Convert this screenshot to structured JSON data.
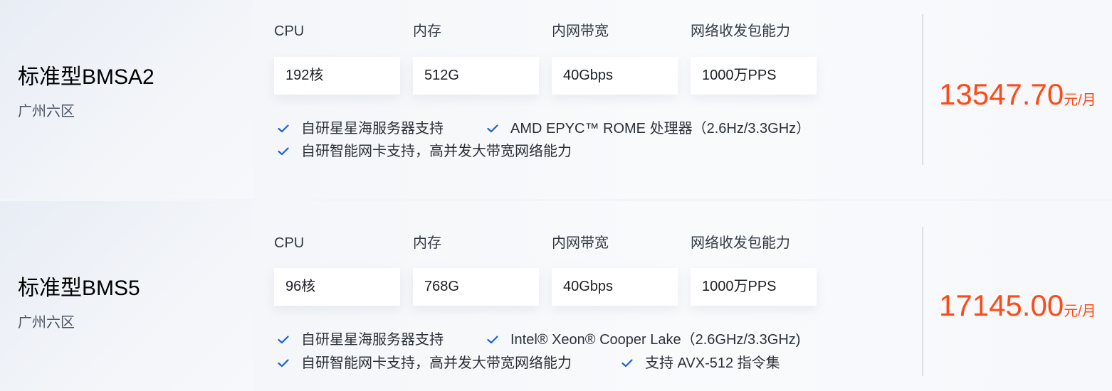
{
  "cards": [
    {
      "name": "标准型BMSA2",
      "region": "广州六区",
      "specs": [
        {
          "label": "CPU",
          "value": "192核"
        },
        {
          "label": "内存",
          "value": "512G"
        },
        {
          "label": "内网带宽",
          "value": "40Gbps"
        },
        {
          "label": "网络收发包能力",
          "value": "1000万PPS"
        }
      ],
      "features": [
        "自研星星海服务器支持",
        "AMD EPYC™ ROME 处理器（2.6Hz/3.3GHz）",
        "自研智能网卡支持，高并发大带宽网络能力"
      ],
      "price": "13547.70",
      "price_unit": "元/月"
    },
    {
      "name": "标准型BMS5",
      "region": "广州六区",
      "specs": [
        {
          "label": "CPU",
          "value": "96核"
        },
        {
          "label": "内存",
          "value": "768G"
        },
        {
          "label": "内网带宽",
          "value": "40Gbps"
        },
        {
          "label": "网络收发包能力",
          "value": "1000万PPS"
        }
      ],
      "features": [
        "自研星星海服务器支持",
        "Intel® Xeon® Cooper Lake（2.6GHz/3.3GHz)",
        "自研智能网卡支持，高并发大带宽网络能力",
        "支持 AVX-512 指令集"
      ],
      "price": "17145.00",
      "price_unit": "元/月"
    }
  ],
  "colors": {
    "accent_price": "#ff4a16",
    "check": "#1d5fd6"
  },
  "icons": {
    "feature_check": "check-icon"
  }
}
